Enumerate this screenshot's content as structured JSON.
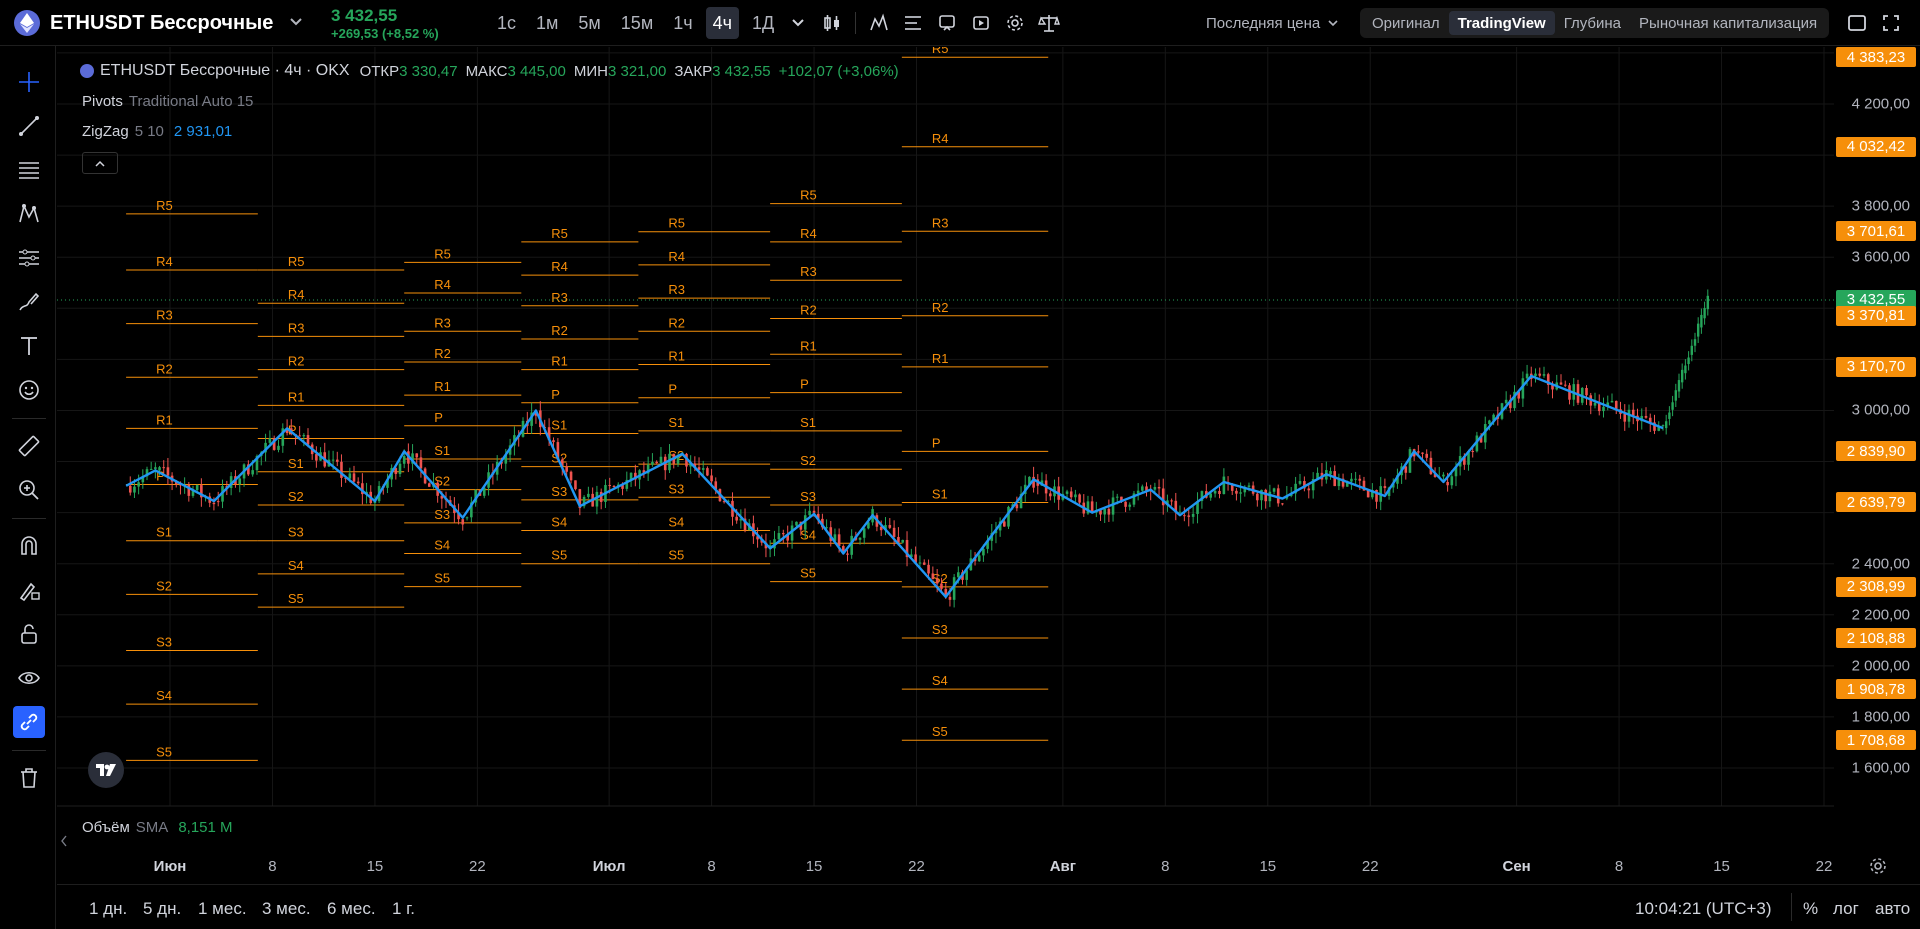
{
  "header": {
    "symbol": "ETHUSDT Бессрочные",
    "last_price": "3 432,55",
    "change": "+269,53 (+8,52 %)",
    "intervals": [
      "1с",
      "1м",
      "5м",
      "15м",
      "1ч",
      "4ч",
      "1Д"
    ],
    "active_interval": "4ч",
    "price_mode": "Последняя цена",
    "view_modes": [
      "Оригинал",
      "TradingView",
      "Глубина",
      "Рыночная капитализация"
    ],
    "active_view": "TradingView"
  },
  "legend": {
    "title": "ETHUSDT Бессрочные · 4ч · OKX",
    "open_label": "ОТКР",
    "open": "3 330,47",
    "high_label": "МАКС",
    "high": "3 445,00",
    "low_label": "МИН",
    "low": "3 321,00",
    "close_label": "ЗАКР",
    "close": "3 432,55",
    "change": "+102,07 (+3,06%)",
    "pivots_name": "Pivots",
    "pivots_params": "Traditional Auto 15",
    "zigzag_name": "ZigZag",
    "zigzag_params": "5 10",
    "zigzag_value": "2 931,01",
    "volume_name": "Объём",
    "volume_ma": "SMA",
    "volume_value": "8,151 M"
  },
  "price_scale": {
    "ticks": [
      "4 200,00",
      "3 800,00",
      "3 600,00",
      "3 000,00",
      "2 400,00",
      "2 200,00",
      "2 000,00",
      "1 800,00",
      "1 600,00"
    ],
    "tags": [
      {
        "label": "4 383,23",
        "type": "pivot"
      },
      {
        "label": "4 032,42",
        "type": "pivot"
      },
      {
        "label": "3 701,61",
        "type": "pivot"
      },
      {
        "label": "3 432,55",
        "type": "last"
      },
      {
        "label": "3 370,81",
        "type": "pivot"
      },
      {
        "label": "3 170,70",
        "type": "pivot"
      },
      {
        "label": "2 839,90",
        "type": "pivot"
      },
      {
        "label": "2 639,79",
        "type": "pivot"
      },
      {
        "label": "2 308,99",
        "type": "pivot"
      },
      {
        "label": "2 108,88",
        "type": "pivot"
      },
      {
        "label": "1 908,78",
        "type": "pivot"
      },
      {
        "label": "1 708,68",
        "type": "pivot"
      }
    ]
  },
  "time_axis": [
    "Июн",
    "8",
    "15",
    "22",
    "Июл",
    "8",
    "15",
    "22",
    "Авг",
    "8",
    "15",
    "22",
    "Сен",
    "8",
    "15",
    "22"
  ],
  "bottom": {
    "ranges": [
      "1 дн.",
      "5 дн.",
      "1 мес.",
      "3 мес.",
      "6 мес.",
      "1 г."
    ],
    "clock": "10:04:21 (UTC+3)",
    "percent": "%",
    "log": "лог",
    "auto": "авто"
  },
  "colors": {
    "pivot": "#f68f0a",
    "zigzag": "#2196f3",
    "up": "#26a65b",
    "down": "#ef5350",
    "active_tool": "#2962ff"
  },
  "pivot_labels": [
    "R5",
    "R4",
    "R3",
    "R2",
    "R1",
    "P",
    "S1",
    "S2",
    "S3",
    "S4",
    "S5"
  ],
  "pivots": [
    {
      "start": "2024-05-29",
      "end": "2024-06-07",
      "R5": 3770,
      "R4": 3550,
      "R3": 3340,
      "R2": 3130,
      "R1": 2930,
      "P": 2710,
      "S1": 2490,
      "S2": 2280,
      "S3": 2060,
      "S4": 1850,
      "S5": 1630
    },
    {
      "start": "2024-06-07",
      "end": "2024-06-17",
      "R5": 3550,
      "R4": 3420,
      "R3": 3290,
      "R2": 3160,
      "R1": 3020,
      "P": 2890,
      "S1": 2760,
      "S2": 2630,
      "S3": 2490,
      "S4": 2360,
      "S5": 2230
    },
    {
      "start": "2024-06-17",
      "end": "2024-06-25",
      "R5": 3580,
      "R4": 3460,
      "R3": 3310,
      "R2": 3190,
      "R1": 3060,
      "P": 2940,
      "S1": 2810,
      "S2": 2690,
      "S3": 2560,
      "S4": 2440,
      "S5": 2310
    },
    {
      "start": "2024-06-25",
      "end": "2024-07-03",
      "R5": 3660,
      "R4": 3530,
      "R3": 3410,
      "R2": 3280,
      "R1": 3160,
      "P": 3030,
      "S1": 2910,
      "S2": 2780,
      "S3": 2650,
      "S4": 2530,
      "S5": 2400
    },
    {
      "start": "2024-07-03",
      "end": "2024-07-12",
      "R5": 3700,
      "R4": 3570,
      "R3": 3440,
      "R2": 3310,
      "R1": 3180,
      "P": 3050,
      "S1": 2920,
      "S2": 2790,
      "S3": 2660,
      "S4": 2530,
      "S5": 2400
    },
    {
      "start": "2024-07-12",
      "end": "2024-07-21",
      "R5": 3810,
      "R4": 3660,
      "R3": 3510,
      "R2": 3360,
      "R1": 3220,
      "P": 3070,
      "S1": 2920,
      "S2": 2770,
      "S3": 2630,
      "S4": 2480,
      "S5": 2330
    },
    {
      "start": "2024-07-21",
      "end": "2024-07-31",
      "R5": 4383.23,
      "R4": 4032.42,
      "R3": 3701.61,
      "R2": 3370.81,
      "R1": 3170.7,
      "P": 2839.9,
      "S1": 2639.79,
      "S2": 2308.99,
      "S3": 2108.88,
      "S4": 1908.78,
      "S5": 1708.68
    }
  ],
  "zigzag": [
    {
      "t": "2024-05-29",
      "v": 2705
    },
    {
      "t": "2024-05-31",
      "v": 2765
    },
    {
      "t": "2024-06-04",
      "v": 2645
    },
    {
      "t": "2024-06-09",
      "v": 2930
    },
    {
      "t": "2024-06-15",
      "v": 2645
    },
    {
      "t": "2024-06-17",
      "v": 2840
    },
    {
      "t": "2024-06-21",
      "v": 2580
    },
    {
      "t": "2024-06-26",
      "v": 3000
    },
    {
      "t": "2024-06-29",
      "v": 2625
    },
    {
      "t": "2024-07-06",
      "v": 2830
    },
    {
      "t": "2024-07-12",
      "v": 2460
    },
    {
      "t": "2024-07-15",
      "v": 2595
    },
    {
      "t": "2024-07-17",
      "v": 2440
    },
    {
      "t": "2024-07-19",
      "v": 2590
    },
    {
      "t": "2024-07-24",
      "v": 2270
    },
    {
      "t": "2024-07-30",
      "v": 2730
    },
    {
      "t": "2024-08-03",
      "v": 2600
    },
    {
      "t": "2024-08-07",
      "v": 2690
    },
    {
      "t": "2024-08-09",
      "v": 2590
    },
    {
      "t": "2024-08-12",
      "v": 2720
    },
    {
      "t": "2024-08-16",
      "v": 2655
    },
    {
      "t": "2024-08-19",
      "v": 2750
    },
    {
      "t": "2024-08-23",
      "v": 2665
    },
    {
      "t": "2024-08-25",
      "v": 2840
    },
    {
      "t": "2024-08-27",
      "v": 2720
    },
    {
      "t": "2024-09-02",
      "v": 3135
    },
    {
      "t": "2024-09-11",
      "v": 2931.01
    }
  ]
}
